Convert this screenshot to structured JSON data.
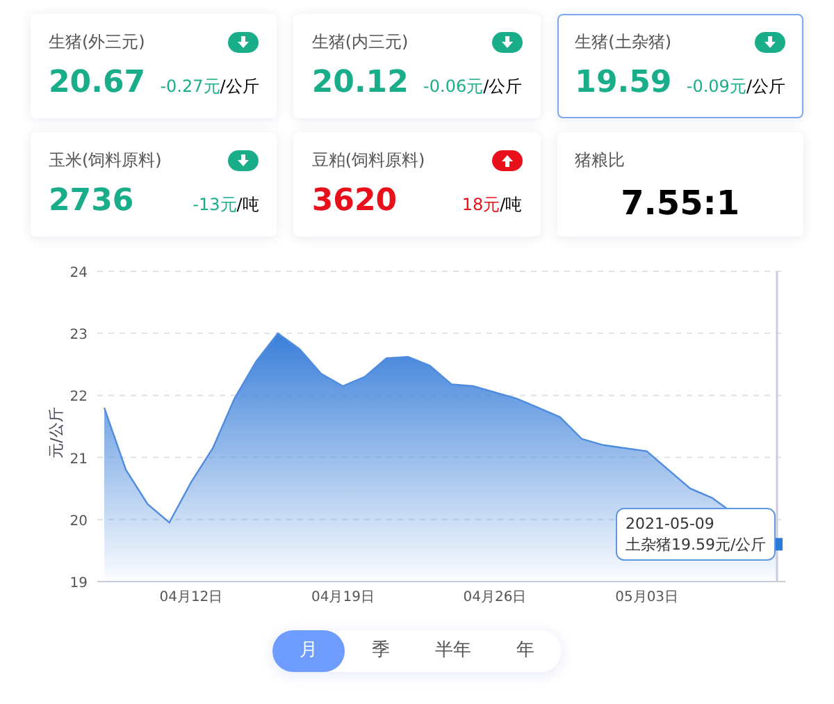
{
  "cards": [
    {
      "title": "生猪(外三元)",
      "kind": "down",
      "selected": false,
      "value": "20.67",
      "change": "-0.27元",
      "unit": "/公斤"
    },
    {
      "title": "生猪(内三元)",
      "kind": "down",
      "selected": false,
      "value": "20.12",
      "change": "-0.06元",
      "unit": "/公斤"
    },
    {
      "title": "生猪(土杂猪)",
      "kind": "down",
      "selected": true,
      "value": "19.59",
      "change": "-0.09元",
      "unit": "/公斤"
    },
    {
      "title": "玉米(饲料原料)",
      "kind": "down",
      "selected": false,
      "value": "2736",
      "change": "-13元",
      "unit": "/吨"
    },
    {
      "title": "豆粕(饲料原料)",
      "kind": "up",
      "selected": false,
      "value": "3620",
      "change": "18元",
      "unit": "/吨"
    },
    {
      "title": "猪粮比",
      "kind": "ratio",
      "selected": false,
      "value": "7.55:1"
    }
  ],
  "chart": {
    "chart_data": {
      "type": "area",
      "grid": true,
      "ylabel": "元/公斤",
      "ylim": [
        19,
        24
      ],
      "yticks": [
        19,
        20,
        21,
        22,
        23,
        24
      ],
      "categories": [
        null,
        null,
        null,
        null,
        "04月12日",
        null,
        null,
        null,
        null,
        null,
        null,
        "04月19日",
        null,
        null,
        null,
        null,
        null,
        null,
        "04月26日",
        null,
        null,
        null,
        null,
        null,
        null,
        "05月03日",
        null,
        null,
        null,
        null,
        null,
        null
      ],
      "series": [
        {
          "color": "#3a7fd9",
          "values": [
            21.8,
            20.8,
            20.25,
            19.95,
            20.6,
            21.15,
            21.95,
            22.55,
            23.0,
            22.75,
            22.35,
            22.15,
            22.3,
            22.6,
            22.62,
            22.48,
            22.18,
            22.15,
            22.05,
            21.95,
            21.8,
            21.65,
            21.3,
            21.2,
            21.15,
            21.1,
            20.8,
            20.5,
            20.35,
            null,
            null,
            19.59
          ]
        }
      ]
    },
    "tooltip": {
      "date": "2021-05-09",
      "text": "土杂猪19.59元/公斤"
    }
  },
  "periods": [
    {
      "label": "月",
      "selected": true
    },
    {
      "label": "季",
      "selected": false
    },
    {
      "label": "半年",
      "selected": false
    },
    {
      "label": "年",
      "selected": false
    }
  ]
}
